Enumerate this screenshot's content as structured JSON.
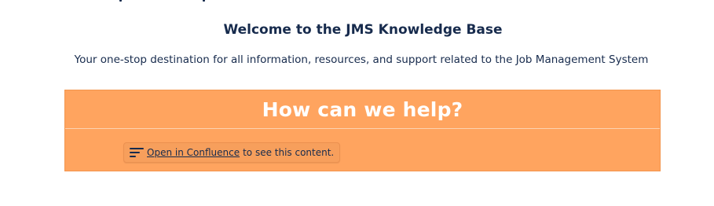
{
  "page": {
    "title": "Welcome to the JMS Knowledge Base",
    "subtitle": "Your one-stop destination for all information, resources, and support related to the Job Management System"
  },
  "help_panel": {
    "heading": "How can we help?",
    "background_color": "#ffa45f",
    "macro": {
      "icon": "lines-icon",
      "link_label": "Open in Confluence",
      "suffix_text": "to see this content."
    }
  }
}
